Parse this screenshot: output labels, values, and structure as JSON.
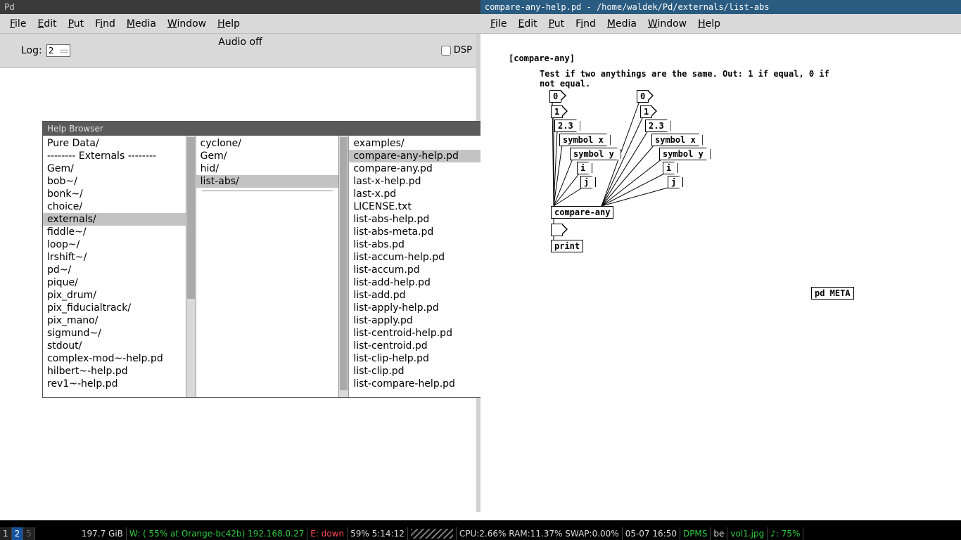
{
  "pd_main": {
    "title": "Pd",
    "menus": [
      {
        "label": "File",
        "ul": "F"
      },
      {
        "label": "Edit",
        "ul": "E"
      },
      {
        "label": "Put",
        "ul": "P"
      },
      {
        "label": "Find",
        "ul": "F"
      },
      {
        "label": "Media",
        "ul": "M"
      },
      {
        "label": "Window",
        "ul": "W"
      },
      {
        "label": "Help",
        "ul": "H"
      }
    ],
    "log_label": "Log:",
    "log_value": "2",
    "audio_status": "Audio off",
    "dsp_label": "DSP"
  },
  "help_browser": {
    "title": "Help Browser",
    "col1": {
      "selected": 6,
      "items": [
        " Pure Data/",
        "-------- Externals --------",
        "Gem/",
        "bob~/",
        "bonk~/",
        "choice/",
        "externals/",
        "fiddle~/",
        "loop~/",
        "lrshift~/",
        "pd~/",
        "pique/",
        "pix_drum/",
        "pix_fiducialtrack/",
        "pix_mano/",
        "sigmund~/",
        "stdout/",
        "complex-mod~-help.pd",
        "hilbert~-help.pd",
        "rev1~-help.pd"
      ]
    },
    "col2": {
      "selected": 3,
      "hasDivider": true,
      "items": [
        "cyclone/",
        "Gem/",
        "hid/",
        "list-abs/"
      ]
    },
    "col3": {
      "selected": 1,
      "items": [
        "examples/",
        "compare-any-help.pd",
        "compare-any.pd",
        "last-x-help.pd",
        "last-x.pd",
        "LICENSE.txt",
        "list-abs-help.pd",
        "list-abs-meta.pd",
        "list-abs.pd",
        "list-accum-help.pd",
        "list-accum.pd",
        "list-add-help.pd",
        "list-add.pd",
        "list-apply-help.pd",
        "list-apply.pd",
        "list-centroid-help.pd",
        "list-centroid.pd",
        "list-clip-help.pd",
        "list-clip.pd",
        "list-compare-help.pd"
      ]
    }
  },
  "patch": {
    "title": "compare-any-help.pd   - /home/waldek/Pd/externals/list-abs",
    "heading": "[compare-any]",
    "desc1": "Test if two anythings are the same. Out: 1 if equal, 0 if",
    "desc2": "not equal.",
    "left_col": {
      "num0": "0",
      "num1": "1",
      "msg23": "2.3",
      "msgsx": "symbol x",
      "msgsy": "symbol y",
      "msgi": "i",
      "msgj": "j"
    },
    "right_col": {
      "num0": "0",
      "num1": "1",
      "msg23": "2.3",
      "msgsx": "symbol x",
      "msgsy": "symbol y",
      "msgi": "i",
      "msgj": "j"
    },
    "compare": "compare-any",
    "print": "print",
    "meta": "pd META"
  },
  "statusbar": {
    "workspaces": [
      "1",
      "2",
      "5"
    ],
    "active_ws": 1,
    "disk": "197.7 GiB",
    "wifi_label": "W:",
    "wifi_value": "( 55% at Orange-bc42b) 192.168.0.27",
    "eth_label": "E:",
    "eth_value": "down",
    "batt": "59% 5:14:12",
    "cpu": "CPU:2.66% RAM:11.37% SWAP:0.00%",
    "date": "05-07 16:50",
    "dpms": "DPMS",
    "kb": "be",
    "vol": "vol1.jpg",
    "music": "♪: 75%"
  }
}
